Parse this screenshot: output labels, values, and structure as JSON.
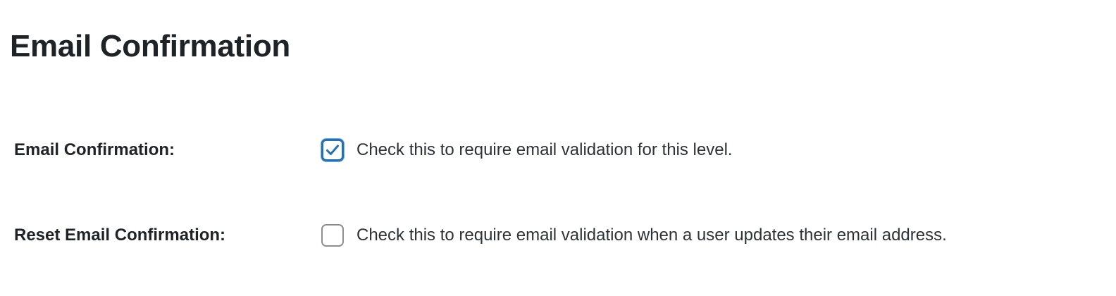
{
  "page": {
    "title": "Email Confirmation"
  },
  "settings": [
    {
      "label": "Email Confirmation:",
      "description": "Check this to require email validation for this level.",
      "checked": true
    },
    {
      "label": "Reset Email Confirmation:",
      "description": "Check this to require email validation when a user updates their email address.",
      "checked": false
    }
  ],
  "icons": {
    "checkmark": "checkmark-icon"
  },
  "colors": {
    "text": "#1d2327",
    "checkbox_checked_border": "#2271b1",
    "checkbox_unchecked_border": "#8c8f94"
  }
}
